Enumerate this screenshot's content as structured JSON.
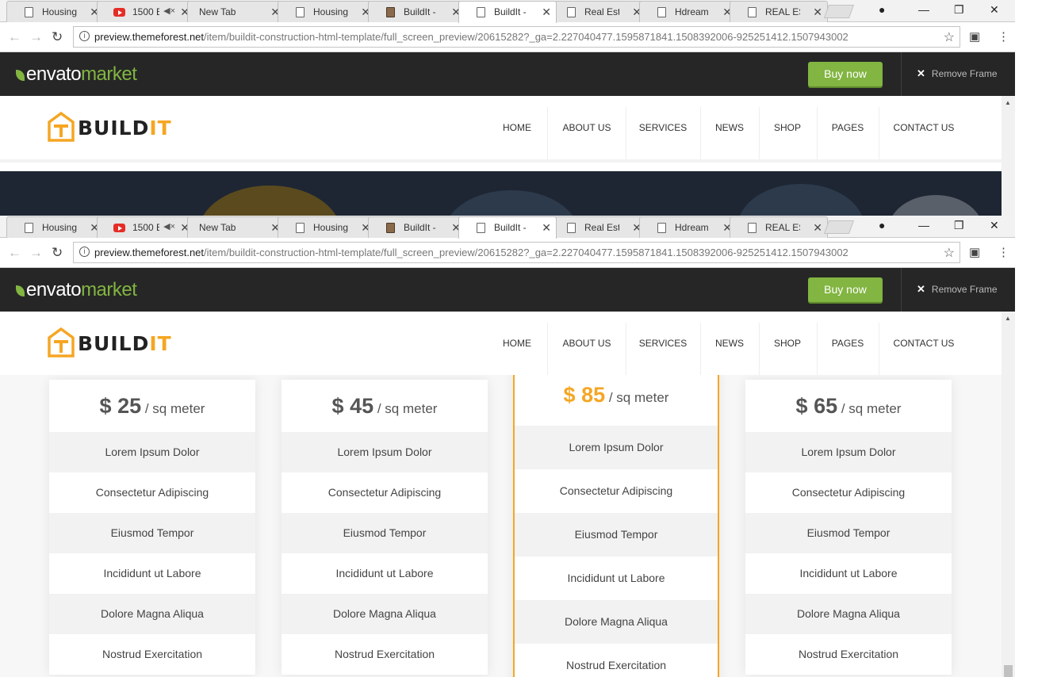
{
  "browser": {
    "tabs": [
      {
        "label": "Housing p",
        "icon": "page-icon"
      },
      {
        "label": "1500 E",
        "icon": "youtube-icon",
        "muted": true
      },
      {
        "label": "New Tab",
        "icon": "none"
      },
      {
        "label": "Housing p",
        "icon": "page-icon"
      },
      {
        "label": "BuildIt - C",
        "icon": "image-icon"
      },
      {
        "label": "BuildIt - C",
        "icon": "page-icon",
        "active": true
      },
      {
        "label": "Real Estat",
        "icon": "page-icon"
      },
      {
        "label": "Hdream -",
        "icon": "page-icon"
      },
      {
        "label": "REAL ESTA",
        "icon": "page-icon"
      }
    ],
    "url_host": "preview.themeforest.net",
    "url_path": "/item/buildit-construction-html-template/full_screen_preview/20615282?_ga=2.227040477.1595871841.1508392006-925251412.1507943002"
  },
  "envato": {
    "logo_main": "envato",
    "logo_accent": "market",
    "buy_label": "Buy now",
    "remove_label": "Remove Frame",
    "accent_color": "#82b541"
  },
  "site": {
    "brand_dark": "BUILD",
    "brand_accent": "IT",
    "accent_color": "#f5a623",
    "menu": [
      "HOME",
      "ABOUT US",
      "SERVICES",
      "NEWS",
      "SHOP",
      "PAGES",
      "CONTACT US"
    ]
  },
  "pricing": {
    "currency": "$",
    "unit": "/ sq meter",
    "plans": [
      {
        "amount": "25",
        "featured": false
      },
      {
        "amount": "45",
        "featured": false
      },
      {
        "amount": "85",
        "featured": true
      },
      {
        "amount": "65",
        "featured": false
      }
    ],
    "features": [
      "Lorem Ipsum Dolor",
      "Consectetur Adipiscing",
      "Eiusmod Tempor",
      "Incididunt ut Labore",
      "Dolore Magna Aliqua",
      "Nostrud Exercitation"
    ]
  }
}
